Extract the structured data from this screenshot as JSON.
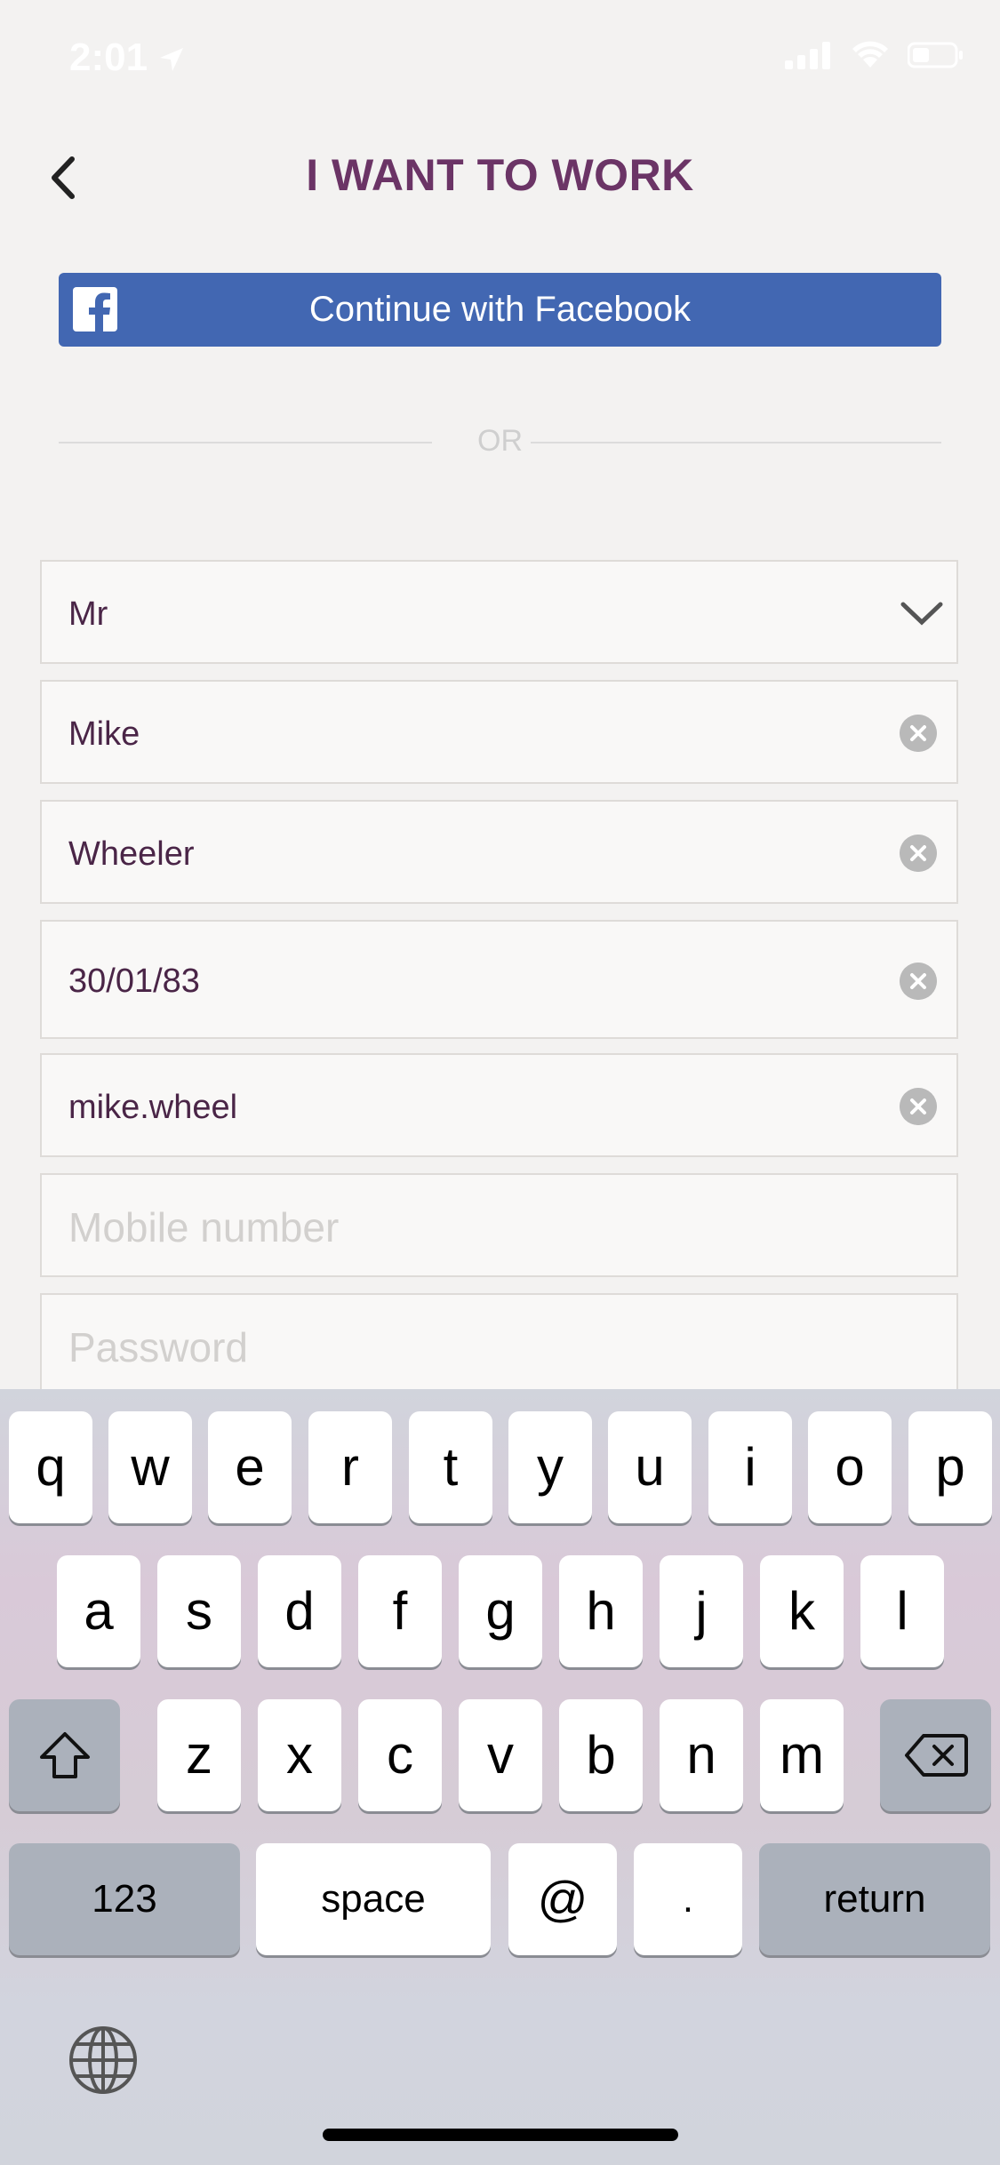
{
  "status_bar": {
    "time": "2:01"
  },
  "header": {
    "title": "I WANT TO WORK"
  },
  "facebook_button": {
    "label": "Continue with Facebook"
  },
  "divider": {
    "label": "OR"
  },
  "form": {
    "title_select": {
      "value": "Mr"
    },
    "first_name": {
      "value": "Mike"
    },
    "last_name": {
      "value": "Wheeler"
    },
    "dob": {
      "value": "30/01/83"
    },
    "email": {
      "value": "mike.wheel"
    },
    "mobile": {
      "placeholder": "Mobile number"
    },
    "password": {
      "placeholder": "Password"
    }
  },
  "keyboard": {
    "row1": [
      "q",
      "w",
      "e",
      "r",
      "t",
      "y",
      "u",
      "i",
      "o",
      "p"
    ],
    "row2": [
      "a",
      "s",
      "d",
      "f",
      "g",
      "h",
      "j",
      "k",
      "l"
    ],
    "row3": [
      "z",
      "x",
      "c",
      "v",
      "b",
      "n",
      "m"
    ],
    "numbers_key": "123",
    "space_key": "space",
    "at_key": "@",
    "dot_key": ".",
    "return_key": "return"
  },
  "colors": {
    "accent": "#6b3466",
    "facebook": "#4267b2",
    "field_text": "#4a2547"
  }
}
